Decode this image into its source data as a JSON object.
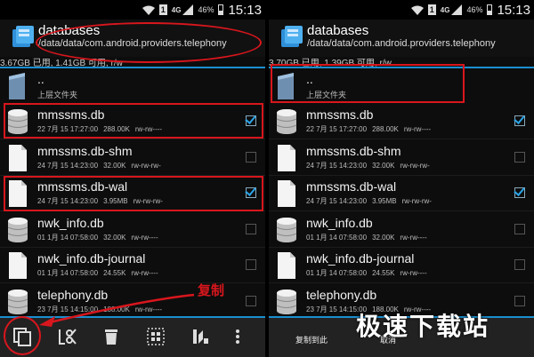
{
  "status": {
    "network": "4G",
    "sim": "1",
    "battery": "46%",
    "time": "15:13"
  },
  "left": {
    "title": "databases",
    "path": "/data/data/com.android.providers.telephony",
    "storage": "3.67GB 已用, 1.41GB 可用, r/w",
    "parent": {
      "name": "..",
      "label": "上层文件夹"
    },
    "files": [
      {
        "name": "mmssms.db",
        "date": "22 7月 15 17:27:00",
        "size": "288.00K",
        "perm": "rw-rw----",
        "icon": "database-icon",
        "checked": true
      },
      {
        "name": "mmssms.db-shm",
        "date": "24 7月 15 14:23:00",
        "size": "32.00K",
        "perm": "rw-rw-rw-",
        "icon": "file-icon",
        "checked": false
      },
      {
        "name": "mmssms.db-wal",
        "date": "24 7月 15 14:23:00",
        "size": "3.95MB",
        "perm": "rw-rw-rw-",
        "icon": "file-icon",
        "checked": true
      },
      {
        "name": "nwk_info.db",
        "date": "01 1月 14 07:58:00",
        "size": "32.00K",
        "perm": "rw-rw----",
        "icon": "database-icon",
        "checked": false
      },
      {
        "name": "nwk_info.db-journal",
        "date": "01 1月 14 07:58:00",
        "size": "24.55K",
        "perm": "rw-rw----",
        "icon": "file-icon",
        "checked": false
      },
      {
        "name": "telephony.db",
        "date": "23 7月 15 14:15:00",
        "size": "188.00K",
        "perm": "rw-rw----",
        "icon": "database-icon",
        "checked": false
      }
    ],
    "annotation": "复制"
  },
  "right": {
    "title": "databases",
    "path": "/data/data/com.android.providers.telephony",
    "storage": "3.70GB 已用, 1.39GB 可用, r/w",
    "parent": {
      "name": "..",
      "label": "上层文件夹"
    },
    "files": [
      {
        "name": "mmssms.db",
        "date": "22 7月 15 17:27:00",
        "size": "288.00K",
        "perm": "rw-rw----",
        "icon": "database-icon",
        "checked": true
      },
      {
        "name": "mmssms.db-shm",
        "date": "24 7月 15 14:23:00",
        "size": "32.00K",
        "perm": "rw-rw-rw-",
        "icon": "file-icon",
        "checked": false
      },
      {
        "name": "mmssms.db-wal",
        "date": "24 7月 15 14:23:00",
        "size": "3.95MB",
        "perm": "rw-rw-rw-",
        "icon": "file-icon",
        "checked": true
      },
      {
        "name": "nwk_info.db",
        "date": "01 1月 14 07:58:00",
        "size": "32.00K",
        "perm": "rw-rw----",
        "icon": "database-icon",
        "checked": false
      },
      {
        "name": "nwk_info.db-journal",
        "date": "01 1月 14 07:58:00",
        "size": "24.55K",
        "perm": "rw-rw----",
        "icon": "file-icon",
        "checked": false
      },
      {
        "name": "telephony.db",
        "date": "23 7月 15 14:15:00",
        "size": "188.00K",
        "perm": "rw-rw----",
        "icon": "database-icon",
        "checked": false
      }
    ],
    "toolbar": {
      "copy_here": "复制到此",
      "cancel": "取消"
    }
  },
  "watermark": "极速下载站",
  "colors": {
    "accent": "#1a8fd0",
    "annotation": "#d8161d",
    "check": "#2aa3e6"
  }
}
